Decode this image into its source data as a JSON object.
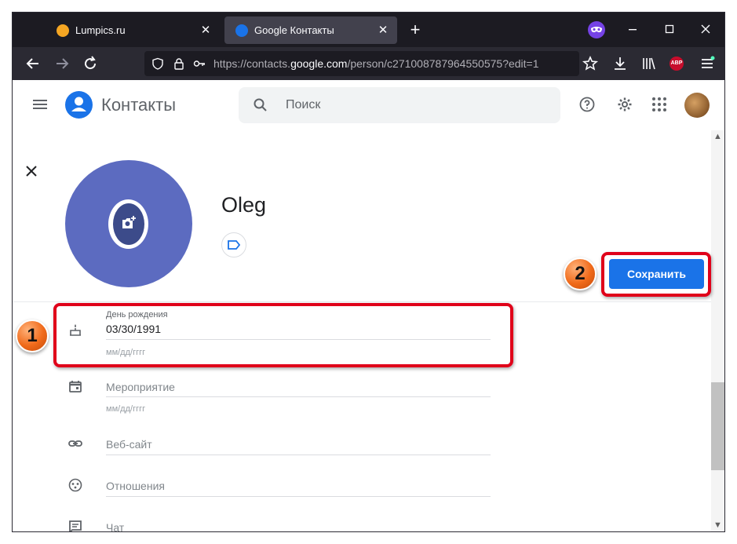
{
  "browser": {
    "tabs": [
      {
        "title": "Lumpics.ru",
        "favicon_color": "#f5a623",
        "active": false
      },
      {
        "title": "Google Контакты",
        "favicon_color": "#1a73e8",
        "active": true
      }
    ],
    "newtab_glyph": "+",
    "url": {
      "prefix": "https://contacts.",
      "host": "google.com",
      "path": "/person/c2710087879645505​75?edit=1"
    },
    "abp_label": "ABP"
  },
  "app": {
    "title": "Контакты",
    "search_placeholder": "Поиск"
  },
  "contact": {
    "name": "Oleg"
  },
  "actions": {
    "save_label": "Сохранить"
  },
  "fields": {
    "birthday": {
      "label": "День рождения",
      "value": "03/30/1991",
      "hint": "мм/дд/гггг"
    },
    "event": {
      "label": "Мероприятие",
      "hint": "мм/дд/гггг"
    },
    "website": {
      "label": "Веб-сайт"
    },
    "relation": {
      "label": "Отношения"
    },
    "chat": {
      "label": "Чат"
    }
  },
  "annotations": {
    "step1": "1",
    "step2": "2"
  },
  "colors": {
    "accent": "#1a73e8",
    "highlight": "#e0001a",
    "badge": "#f06a1a",
    "avatar_bg": "#5c6bc0"
  }
}
